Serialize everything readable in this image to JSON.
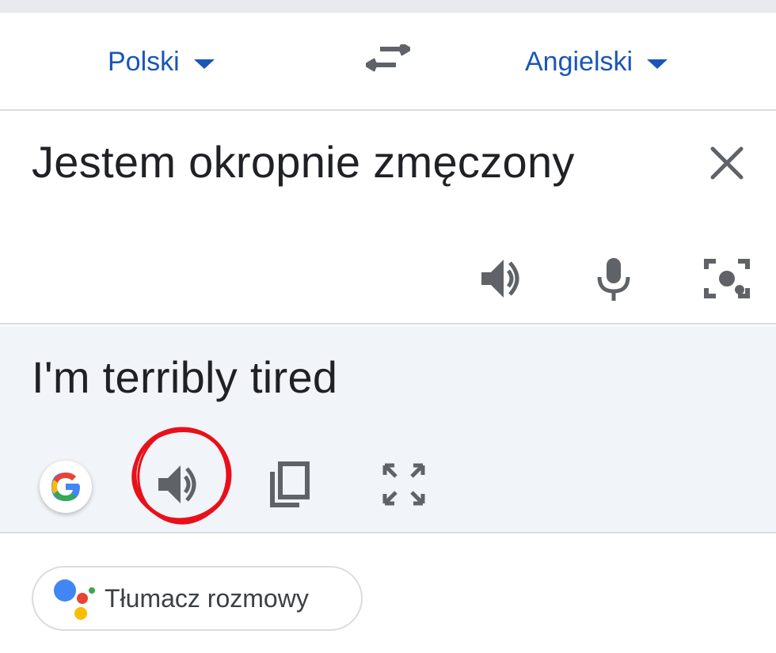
{
  "language_bar": {
    "source_language": "Polski",
    "target_language": "Angielski",
    "swap_icon": "swap-arrows-icon",
    "accent_color": "#1a56b8"
  },
  "source_panel": {
    "text": "Jestem okropnie zmęczony",
    "clear_icon": "close-icon",
    "actions": [
      "speaker-icon",
      "microphone-icon",
      "camera-icon"
    ]
  },
  "result_panel": {
    "text": "I'm terribly tired",
    "background": "#f1f4f8",
    "actions": [
      "google-logo-icon",
      "speaker-icon",
      "copy-icon",
      "fullscreen-icon"
    ],
    "annotation_color": "#e8101a"
  },
  "conversation_button": {
    "label": "Tłumacz rozmowy",
    "icon": "google-assistant-icon"
  }
}
